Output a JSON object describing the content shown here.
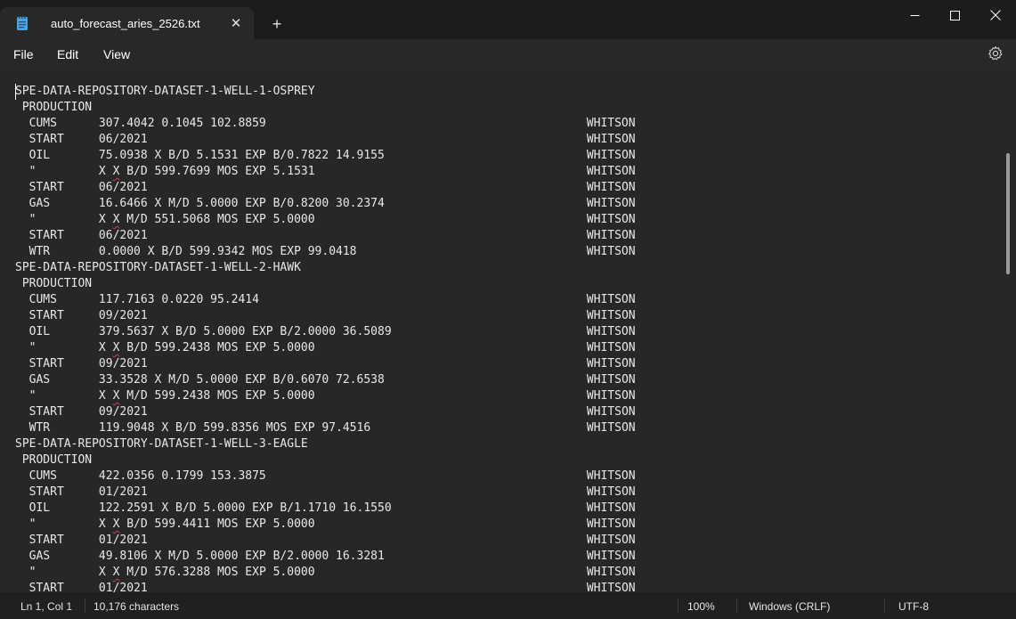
{
  "window": {
    "tab_title": "auto_forecast_aries_2526.txt",
    "tab_close_symbol": "✕",
    "new_tab_symbol": "+",
    "accent_color": "#4ca3e0"
  },
  "menu": {
    "file": "File",
    "edit": "Edit",
    "view": "View"
  },
  "editor": {
    "lines": [
      {
        "text": "SPE-DATA-REPOSITORY-DATASET-1-WELL-1-OSPREY",
        "right": ""
      },
      {
        "text": " PRODUCTION",
        "right": ""
      },
      {
        "text": "  CUMS      307.4042 0.1045 102.8859",
        "right": "WHITSON"
      },
      {
        "text": "  START     06/2021",
        "right": "WHITSON"
      },
      {
        "text": "  OIL       75.0938 X B/D 5.1531 EXP B/0.7822 14.9155",
        "right": "WHITSON"
      },
      {
        "text": "  \"         X X B/D 599.7699 MOS EXP 5.1531",
        "right": "WHITSON",
        "squig": true
      },
      {
        "text": "  START     06/2021",
        "right": "WHITSON"
      },
      {
        "text": "  GAS       16.6466 X M/D 5.0000 EXP B/0.8200 30.2374",
        "right": "WHITSON"
      },
      {
        "text": "  \"         X X M/D 551.5068 MOS EXP 5.0000",
        "right": "WHITSON",
        "squig": true
      },
      {
        "text": "  START     06/2021",
        "right": "WHITSON"
      },
      {
        "text": "  WTR       0.0000 X B/D 599.9342 MOS EXP 99.0418",
        "right": "WHITSON"
      },
      {
        "text": "SPE-DATA-REPOSITORY-DATASET-1-WELL-2-HAWK",
        "right": ""
      },
      {
        "text": " PRODUCTION",
        "right": ""
      },
      {
        "text": "  CUMS      117.7163 0.0220 95.2414",
        "right": "WHITSON"
      },
      {
        "text": "  START     09/2021",
        "right": "WHITSON"
      },
      {
        "text": "  OIL       379.5637 X B/D 5.0000 EXP B/2.0000 36.5089",
        "right": "WHITSON"
      },
      {
        "text": "  \"         X X B/D 599.2438 MOS EXP 5.0000",
        "right": "WHITSON",
        "squig": true
      },
      {
        "text": "  START     09/2021",
        "right": "WHITSON"
      },
      {
        "text": "  GAS       33.3528 X M/D 5.0000 EXP B/0.6070 72.6538",
        "right": "WHITSON"
      },
      {
        "text": "  \"         X X M/D 599.2438 MOS EXP 5.0000",
        "right": "WHITSON",
        "squig": true
      },
      {
        "text": "  START     09/2021",
        "right": "WHITSON"
      },
      {
        "text": "  WTR       119.9048 X B/D 599.8356 MOS EXP 97.4516",
        "right": "WHITSON"
      },
      {
        "text": "SPE-DATA-REPOSITORY-DATASET-1-WELL-3-EAGLE",
        "right": ""
      },
      {
        "text": " PRODUCTION",
        "right": ""
      },
      {
        "text": "  CUMS      422.0356 0.1799 153.3875",
        "right": "WHITSON"
      },
      {
        "text": "  START     01/2021",
        "right": "WHITSON"
      },
      {
        "text": "  OIL       122.2591 X B/D 5.0000 EXP B/1.1710 16.1550",
        "right": "WHITSON"
      },
      {
        "text": "  \"         X X B/D 599.4411 MOS EXP 5.0000",
        "right": "WHITSON",
        "squig": true
      },
      {
        "text": "  START     01/2021",
        "right": "WHITSON"
      },
      {
        "text": "  GAS       49.8106 X M/D 5.0000 EXP B/2.0000 16.3281",
        "right": "WHITSON"
      },
      {
        "text": "  \"         X X M/D 576.3288 MOS EXP 5.0000",
        "right": "WHITSON",
        "squig": true
      },
      {
        "text": "  START     01/2021",
        "right": "WHITSON"
      }
    ]
  },
  "status": {
    "position": "Ln 1, Col 1",
    "characters": "10,176 characters",
    "zoom": "100%",
    "line_ending": "Windows (CRLF)",
    "encoding": "UTF-8"
  }
}
